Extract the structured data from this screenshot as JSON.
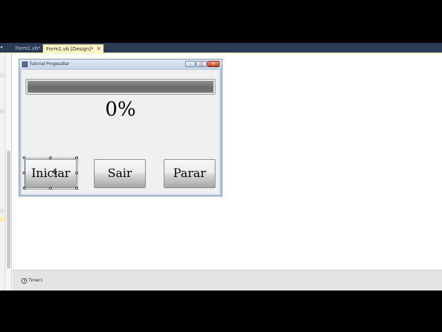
{
  "tabs": [
    {
      "label": "Form1.vb*",
      "active": false
    },
    {
      "label": "Form1.vb [Design]*",
      "active": true
    }
  ],
  "form": {
    "title": "Tutorial ProgessBar",
    "progress_value": 0,
    "percent_text": "0%",
    "buttons": {
      "start": "Iniciar",
      "exit": "Sair",
      "stop": "Parar"
    }
  },
  "tray": {
    "timer_label": "Timer1"
  },
  "icons": {
    "tab_close": "close-icon",
    "form": "form-icon",
    "timer": "timer-icon",
    "cursor": "move-cursor-icon"
  }
}
